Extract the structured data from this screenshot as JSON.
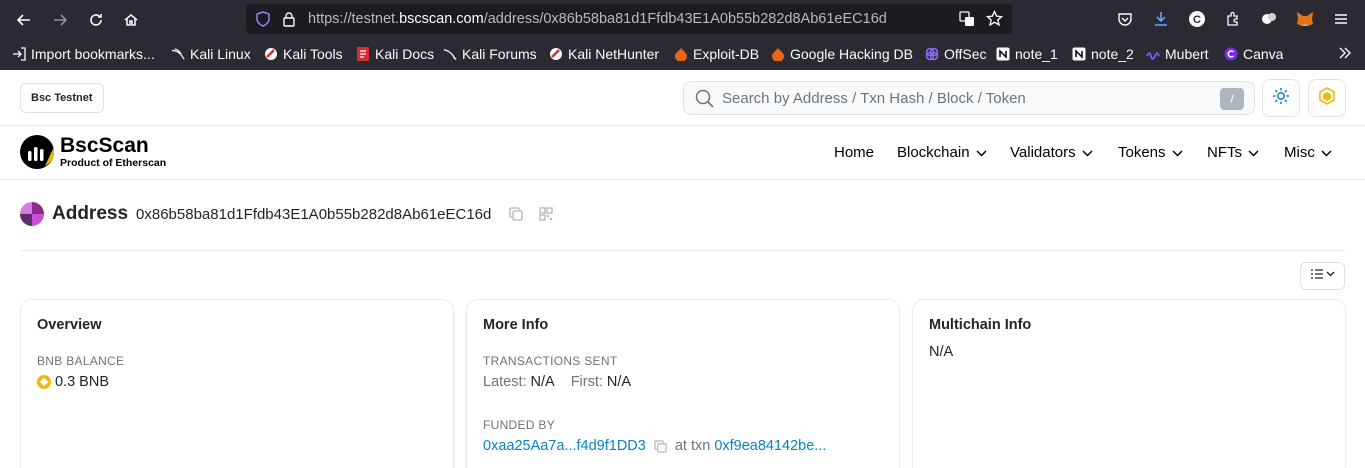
{
  "browser": {
    "url_prefix": "https://testnet.",
    "url_host": "bscscan.com",
    "url_path": "/address/0x86b58ba81d1Ffdb43E1A0b55b282d8Ab61eEC16d",
    "bookmarks": [
      {
        "label": "Import bookmarks...",
        "icon": "import-icon"
      },
      {
        "label": "Kali Linux",
        "icon": "kali-dragon-icon"
      },
      {
        "label": "Kali Tools",
        "icon": "kali-tools-icon"
      },
      {
        "label": "Kali Docs",
        "icon": "kali-docs-icon"
      },
      {
        "label": "Kali Forums",
        "icon": "kali-forums-icon"
      },
      {
        "label": "Kali NetHunter",
        "icon": "nethunter-icon"
      },
      {
        "label": "Exploit-DB",
        "icon": "exploit-db-icon"
      },
      {
        "label": "Google Hacking DB",
        "icon": "ghdb-icon"
      },
      {
        "label": "OffSec",
        "icon": "offsec-icon"
      },
      {
        "label": "note_1",
        "icon": "notion-icon"
      },
      {
        "label": "note_2",
        "icon": "notion-icon"
      },
      {
        "label": "Mubert",
        "icon": "mubert-icon"
      },
      {
        "label": "Canva",
        "icon": "canva-icon"
      }
    ]
  },
  "site": {
    "network_badge": "Bsc Testnet",
    "search_placeholder": "Search by Address / Txn Hash / Block / Token",
    "search_shortcut": "/",
    "brand_name": "BscScan",
    "brand_sub": "Product of Etherscan",
    "nav": [
      "Home",
      "Blockchain",
      "Validators",
      "Tokens",
      "NFTs",
      "Misc"
    ]
  },
  "address": {
    "title": "Address",
    "value": "0x86b58ba81d1Ffdb43E1A0b55b282d8Ab61eEC16d"
  },
  "overview": {
    "title": "Overview",
    "balance_label": "BNB BALANCE",
    "balance_value": "0.3 BNB"
  },
  "more_info": {
    "title": "More Info",
    "tx_sent_label": "TRANSACTIONS SENT",
    "latest_label": "Latest:",
    "latest_value": "N/A",
    "first_label": "First:",
    "first_value": "N/A",
    "funded_by_label": "FUNDED BY",
    "funded_by_address": "0xaa25Aa7a...f4d9f1DD3",
    "at_txn_label": "at txn",
    "funded_txn": "0xf9ea84142be..."
  },
  "multichain": {
    "title": "Multichain Info",
    "value": "N/A"
  },
  "colors": {
    "accent": "#0784c3",
    "bnb": "#f0b90b",
    "chrome_bg": "#2b2a33"
  }
}
